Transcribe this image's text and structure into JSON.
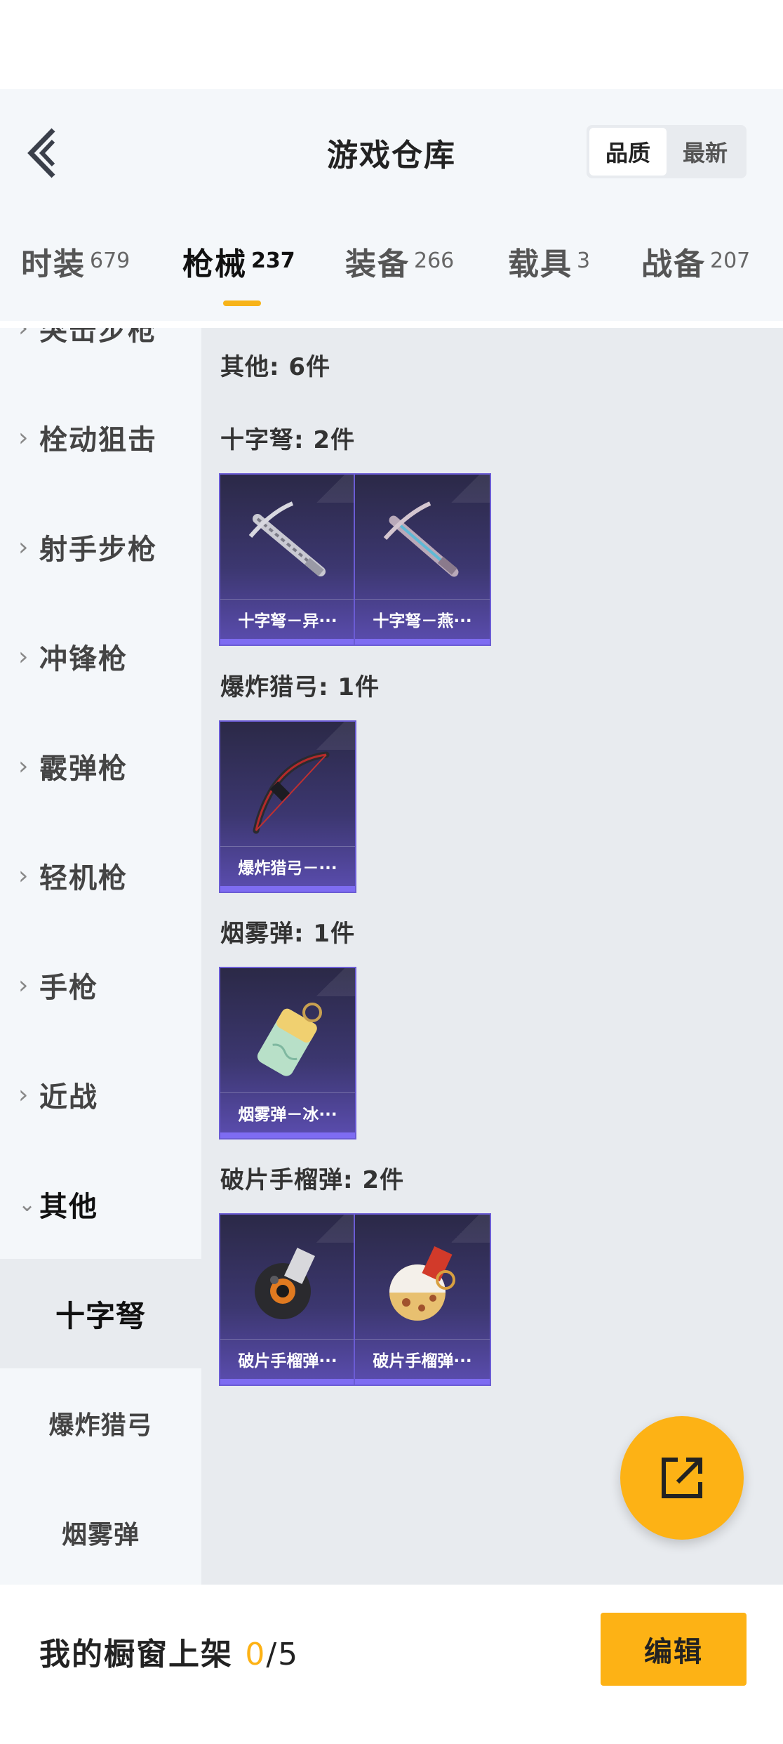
{
  "header": {
    "title": "游戏仓库",
    "sort_options": [
      "品质",
      "最新"
    ],
    "active_sort": "品质"
  },
  "tabs": [
    {
      "label": "时装",
      "count": "679"
    },
    {
      "label": "枪械",
      "count": "237"
    },
    {
      "label": "装备",
      "count": "266"
    },
    {
      "label": "载具",
      "count": "3"
    },
    {
      "label": "战备",
      "count": "207"
    }
  ],
  "active_tab": "枪械",
  "sidebar": {
    "categories": [
      "突击步枪",
      "栓动狙击",
      "射手步枪",
      "冲锋枪",
      "霰弹枪",
      "轻机枪",
      "手枪",
      "近战",
      "其他"
    ],
    "expanded": "其他",
    "subcategories": [
      "十字弩",
      "爆炸猎弓",
      "烟雾弹"
    ],
    "active_sub": "十字弩"
  },
  "content": {
    "summary": "其他: 6件",
    "groups": [
      {
        "title": "十字弩: 2件",
        "items": [
          {
            "name": "十字弩－异···",
            "icon": "crossbow-icon"
          },
          {
            "name": "十字弩－燕···",
            "icon": "crossbow-icon"
          }
        ]
      },
      {
        "title": "爆炸猎弓: 1件",
        "items": [
          {
            "name": "爆炸猎弓－···",
            "icon": "bow-icon"
          }
        ]
      },
      {
        "title": "烟雾弹: 1件",
        "items": [
          {
            "name": "烟雾弹－冰···",
            "icon": "smoke-grenade-icon"
          }
        ]
      },
      {
        "title": "破片手榴弹: 2件",
        "items": [
          {
            "name": "破片手榴弹···",
            "icon": "grenade-icon"
          },
          {
            "name": "破片手榴弹···",
            "icon": "grenade-icon"
          }
        ]
      }
    ]
  },
  "footer": {
    "showcase_label": "我的橱窗上架",
    "showcase_current": "0",
    "showcase_total": "/5",
    "edit_label": "编辑"
  },
  "colors": {
    "accent": "#fdb215",
    "card_border": "#6b5cd4",
    "card_bar": "#7e6cf2"
  }
}
